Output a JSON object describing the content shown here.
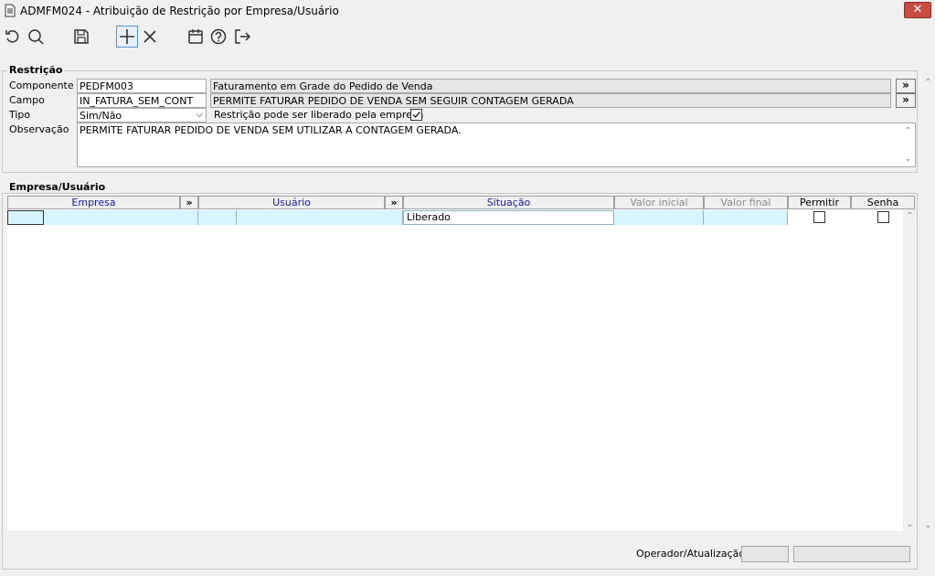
{
  "window": {
    "title": "ADMFM024 - Atribuição de Restrição por Empresa/Usuário",
    "close_icon": "close-icon"
  },
  "toolbar": {
    "icons": [
      "undo-icon",
      "search-icon",
      "save-icon",
      "add-icon",
      "delete-icon",
      "calendar-icon",
      "help-icon",
      "exit-icon"
    ]
  },
  "restricao": {
    "legend": "Restrição",
    "componente_label": "Componente",
    "componente_value": "PEDFM003",
    "componente_desc": "Faturamento em Grade do Pedido de Venda",
    "campo_label": "Campo",
    "campo_value": "IN_FATURA_SEM_CONT",
    "campo_desc": "PERMITE FATURAR PEDIDO DE VENDA SEM SEGUIR CONTAGEM GERADA",
    "tipo_label": "Tipo",
    "tipo_value": "Sim/Não",
    "liberado_label": "Restrição pode ser liberado pela empresa",
    "liberado_checked": true,
    "observacao_label": "Observação",
    "observacao_value": "PERMITE FATURAR PEDIDO DE VENDA SEM UTILIZAR A CONTAGEM GERADA.",
    "more_glyph": "»"
  },
  "empresa_usuario": {
    "legend": "Empresa/Usuário",
    "columns": {
      "empresa": "Empresa",
      "usuario": "Usuário",
      "situacao": "Situação",
      "valor_inicial": "Valor inicial",
      "valor_final": "Valor final",
      "permitir": "Permitir",
      "senha": "Senha"
    },
    "rows": [
      {
        "empresa_cod": "",
        "empresa_nome": "",
        "usuario_cod": "",
        "usuario_nome": "",
        "situacao": "Liberado",
        "valor_inicial": "",
        "valor_final": "",
        "permitir": false,
        "senha": false
      }
    ]
  },
  "footer": {
    "operador_label": "Operador/Atualização"
  }
}
